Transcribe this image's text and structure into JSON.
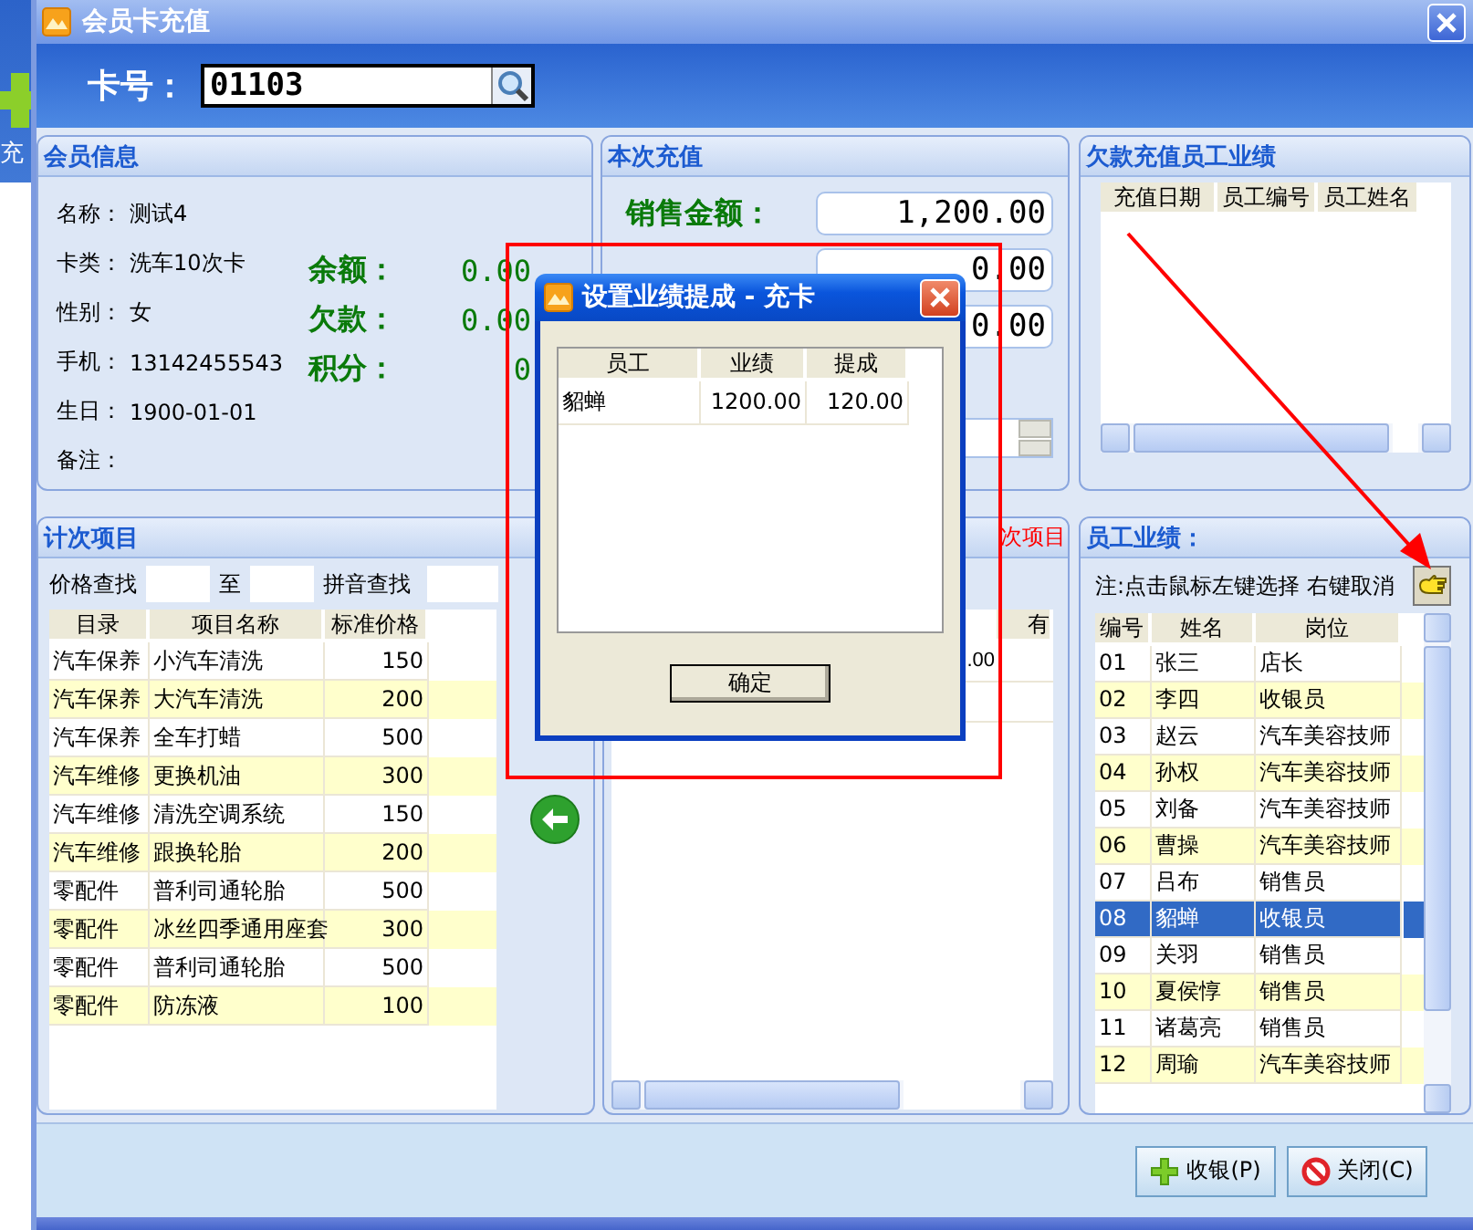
{
  "background_window": {
    "label": "充"
  },
  "window": {
    "title": "会员卡充值"
  },
  "card_search": {
    "label": "卡号：",
    "value": "01103"
  },
  "member_info": {
    "title": "会员信息",
    "fields": [
      {
        "label": "名称：",
        "value": "测试4"
      },
      {
        "label": "卡类：",
        "value": "洗车10次卡"
      },
      {
        "label": "性别：",
        "value": "女"
      },
      {
        "label": "手机：",
        "value": "13142455543"
      },
      {
        "label": "生日：",
        "value": "1900-01-01"
      },
      {
        "label": "备注："
      }
    ],
    "balances": [
      {
        "label": "余额：",
        "value": "0.00"
      },
      {
        "label": "欠款：",
        "value": "0.00"
      },
      {
        "label": "积分：",
        "value": "0"
      }
    ]
  },
  "recharge": {
    "title": "本次充值",
    "fields": [
      {
        "label": "销售金额：",
        "value": "1,200.00"
      },
      {
        "value": "0.00"
      },
      {
        "value": "0.00"
      }
    ]
  },
  "arrears_performance": {
    "title": "欠款充值员工业绩",
    "columns": [
      "充值日期",
      "员工编号",
      "员工姓名"
    ]
  },
  "count_items": {
    "title": "计次项目",
    "price_search_label": "价格查找",
    "to_label": "至",
    "pinyin_search_label": "拼音查找",
    "columns": [
      "目录",
      "项目名称",
      "标准价格"
    ],
    "rows": [
      [
        "汽车保养",
        "小汽车清洗",
        "150"
      ],
      [
        "汽车保养",
        "大汽车清洗",
        "200"
      ],
      [
        "汽车保养",
        "全车打蜡",
        "500"
      ],
      [
        "汽车维修",
        "更换机油",
        "300"
      ],
      [
        "汽车维修",
        "清洗空调系统",
        "150"
      ],
      [
        "汽车维修",
        "跟换轮胎",
        "200"
      ],
      [
        "零配件",
        "普利司通轮胎",
        "500"
      ],
      [
        "零配件",
        "冰丝四季通用座套",
        "300"
      ],
      [
        "零配件",
        "普利司通轮胎",
        "500"
      ],
      [
        "零配件",
        "防冻液",
        "100"
      ]
    ]
  },
  "selected_items": {
    "title": "次项目",
    "column_2": "有",
    "row_1_column_1": ".00"
  },
  "staff_performance": {
    "title": "员工业绩：",
    "note": "注:点击鼠标左键选择 右键取消",
    "columns": [
      "编号",
      "姓名",
      "岗位"
    ],
    "rows": [
      {
        "cells": [
          "01",
          "张三",
          "店长"
        ],
        "selected": false
      },
      {
        "cells": [
          "02",
          "李四",
          "收银员"
        ],
        "selected": false
      },
      {
        "cells": [
          "03",
          "赵云",
          "汽车美容技师"
        ],
        "selected": false
      },
      {
        "cells": [
          "04",
          "孙权",
          "汽车美容技师"
        ],
        "selected": false
      },
      {
        "cells": [
          "05",
          "刘备",
          "汽车美容技师"
        ],
        "selected": false
      },
      {
        "cells": [
          "06",
          "曹操",
          "汽车美容技师"
        ],
        "selected": false
      },
      {
        "cells": [
          "07",
          "吕布",
          "销售员"
        ],
        "selected": false
      },
      {
        "cells": [
          "08",
          "貂蝉",
          "收银员"
        ],
        "selected": true
      },
      {
        "cells": [
          "09",
          "关羽",
          "销售员"
        ],
        "selected": false
      },
      {
        "cells": [
          "10",
          "夏侯惇",
          "销售员"
        ],
        "selected": false
      },
      {
        "cells": [
          "11",
          "诸葛亮",
          "销售员"
        ],
        "selected": false
      },
      {
        "cells": [
          "12",
          "周瑜",
          "汽车美容技师"
        ],
        "selected": false
      }
    ]
  },
  "buttons": [
    {
      "label": "收银(P)",
      "kind": "confirm"
    },
    {
      "label": "关闭(C)",
      "kind": "close"
    }
  ],
  "dialog": {
    "title": "设置业绩提成 - 充卡",
    "columns": [
      "员工",
      "业绩",
      "提成"
    ],
    "rows": [
      [
        "貂蝉",
        "1200.00",
        "120.00"
      ]
    ],
    "button": "确定"
  }
}
